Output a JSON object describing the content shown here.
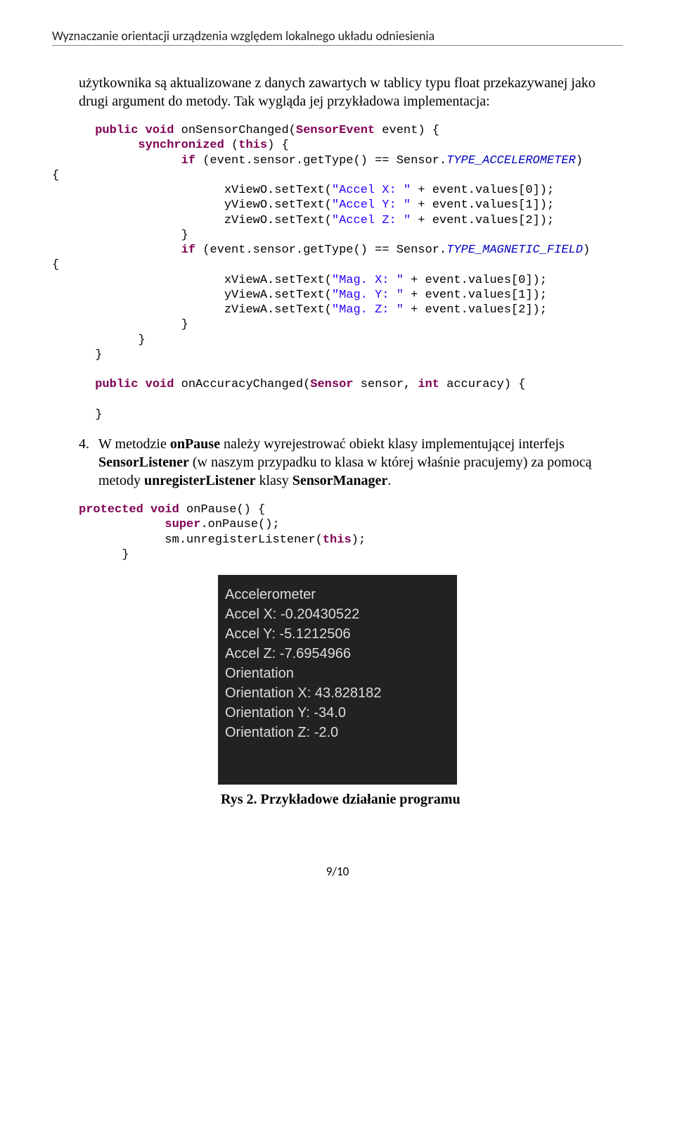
{
  "header": "Wyznaczanie orientacji urządzenia względem lokalnego układu odniesienia",
  "para1": "użytkownika są aktualizowane z danych zawartych w tablicy typu float przekazywanej jako drugi argument do metody.",
  "para2": "Tak wygląda jej przykładowa implementacja:",
  "code": {
    "l01a": "public",
    "l01b": " void",
    "l01c": " onSensorChanged(",
    "l01d": "SensorEvent",
    "l01e": " event) {",
    "l02a": "            synchronized",
    "l02b": " (",
    "l02c": "this",
    "l02d": ") {",
    "l03a": "                  if",
    "l03b": " (event.sensor.getType() == Sensor.",
    "l03c": "TYPE_ACCELEROMETER",
    "l03d": ")",
    "l04": "{",
    "l05a": "                        xViewO.setText(",
    "l05b": "\"Accel X: \"",
    "l05c": " + event.values[0]);",
    "l06a": "                        yViewO.setText(",
    "l06b": "\"Accel Y: \"",
    "l06c": " + event.values[1]);",
    "l07a": "                        zViewO.setText(",
    "l07b": "\"Accel Z: \"",
    "l07c": " + event.values[2]);",
    "l08": "                  }",
    "l09a": "                  if",
    "l09b": " (event.sensor.getType() == Sensor.",
    "l09c": "TYPE_MAGNETIC_FIELD",
    "l09d": ")",
    "l10": "{",
    "l11a": "                        xViewA.setText(",
    "l11b": "\"Mag. X: \"",
    "l11c": " + event.values[0]);",
    "l12a": "                        yViewA.setText(",
    "l12b": "\"Mag. Y: \"",
    "l12c": " + event.values[1]);",
    "l13a": "                        zViewA.setText(",
    "l13b": "\"Mag. Z: \"",
    "l13c": " + event.values[2]);",
    "l14": "                  }",
    "l15": "            }",
    "l16": "      }",
    "l18a": "      public",
    "l18b": " void",
    "l18c": " onAccuracyChanged(",
    "l18d": "Sensor",
    "l18e": " sensor, ",
    "l18f": "int",
    "l18g": " accuracy) {",
    "l19": "      }"
  },
  "list4_num": "4.",
  "list4_a": "W metodzie ",
  "list4_b1": "onPause",
  "list4_c": " należy wyrejestrować  obiekt klasy implementującej interfejs ",
  "list4_b2": "SensorListener",
  "list4_d": " (w naszym przypadku to klasa w której właśnie pracujemy) za pomocą metody ",
  "list4_b3": "unregisterListener",
  "list4_e": "  klasy ",
  "list4_b4": "SensorManager",
  "list4_f": ".",
  "code2": {
    "l1a": "protected",
    "l1b": " void",
    "l1c": " onPause() {",
    "l2a": "            super",
    "l2b": ".onPause();",
    "l3a": "            sm.unregisterListener(",
    "l3b": "this",
    "l3c": ");",
    "l4": "      }"
  },
  "screenshot": {
    "l1": "Accelerometer",
    "l2": "Accel X: -0.20430522",
    "l3": "Accel Y: -5.1212506",
    "l4": "Accel Z: -7.6954966",
    "l5": "Orientation",
    "l6": "Orientation X: 43.828182",
    "l7": "Orientation Y: -34.0",
    "l8": "Orientation Z: -2.0"
  },
  "fig_caption": "Rys 2. Przykładowe działanie programu",
  "page_num": "9/10"
}
